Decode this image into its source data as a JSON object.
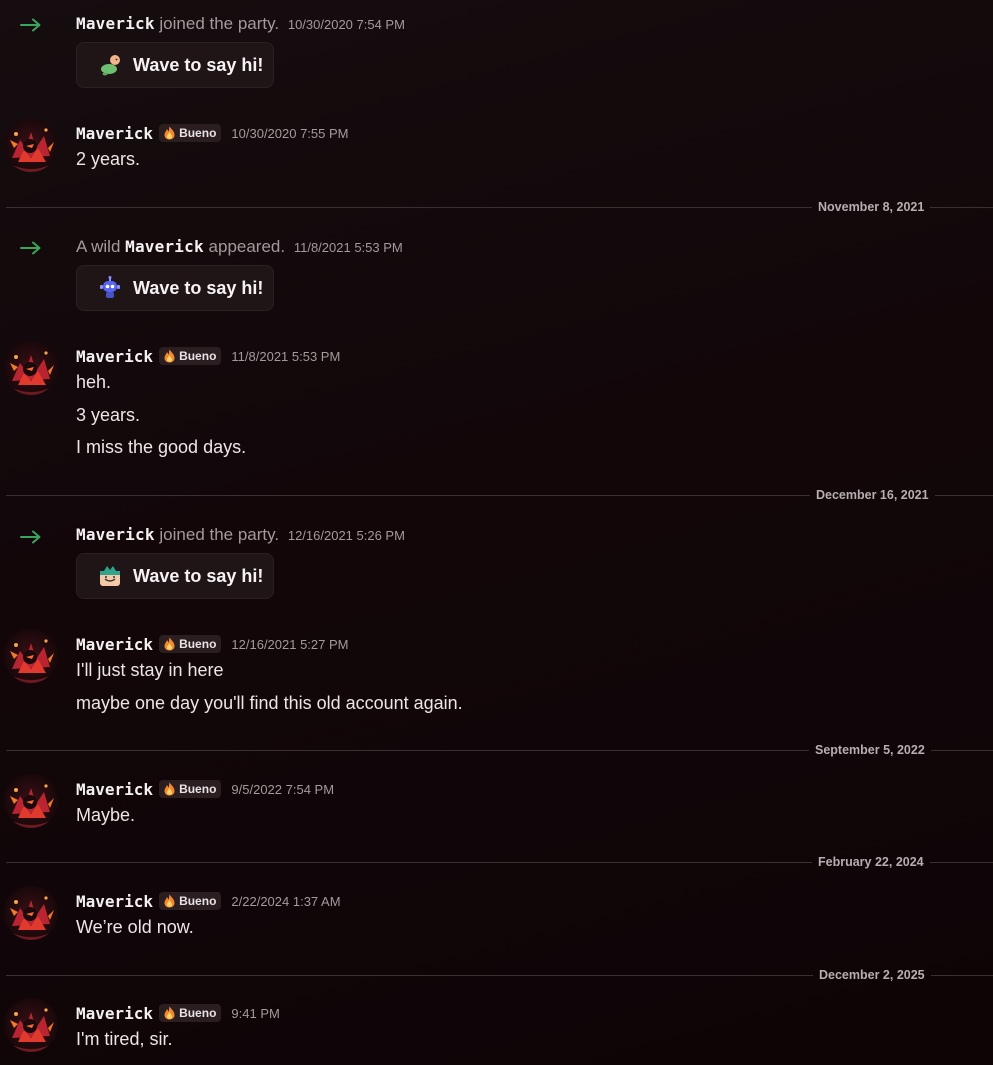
{
  "system_1": {
    "name": "Maverick",
    "after": " joined the party.",
    "time": "10/30/2020 7:54 PM",
    "button": "Wave to say hi!"
  },
  "system_2": {
    "prefix": "A wild ",
    "name": "Maverick",
    "after": " appeared.",
    "time": "11/8/2021 5:53 PM",
    "button": "Wave to say hi!"
  },
  "system_3": {
    "name": "Maverick",
    "after": " joined the party.",
    "time": "12/16/2021 5:26 PM",
    "button": "Wave to say hi!"
  },
  "messages": [
    {
      "author": "Maverick",
      "tag": "Bueno",
      "time": "10/30/2020 7:55 PM",
      "lines": [
        "2 years."
      ]
    },
    {
      "author": "Maverick",
      "tag": "Bueno",
      "time": "11/8/2021 5:53 PM",
      "lines": [
        "heh.",
        "3 years.",
        "I miss the good days."
      ]
    },
    {
      "author": "Maverick",
      "tag": "Bueno",
      "time": "12/16/2021 5:27 PM",
      "lines": [
        "I'll just stay in here",
        "maybe one day you'll find this old account again."
      ]
    },
    {
      "author": "Maverick",
      "tag": "Bueno",
      "time": "9/5/2022 7:54 PM",
      "lines": [
        "Maybe."
      ]
    },
    {
      "author": "Maverick",
      "tag": "Bueno",
      "time": "2/22/2024 1:37 AM",
      "lines": [
        "We’re old now."
      ]
    },
    {
      "author": "Maverick",
      "tag": "Bueno",
      "time": "9:41 PM",
      "lines": [
        "I'm tired, sir."
      ]
    }
  ],
  "dividers": [
    "November 8, 2021",
    "December 16, 2021",
    "September 5, 2022",
    "February 22, 2024",
    "December 2, 2025"
  ],
  "colors": {
    "background": "#120609",
    "arrow": "#3ba55d",
    "divider": "#3a2f31",
    "tag_bg": "#2a1e21"
  },
  "icons": {
    "join_arrow": "arrow-right-icon",
    "tag": "flame-icon",
    "sticker_1": "turtle-sticker",
    "sticker_2": "robot-sticker",
    "sticker_3": "gift-box-sticker"
  }
}
